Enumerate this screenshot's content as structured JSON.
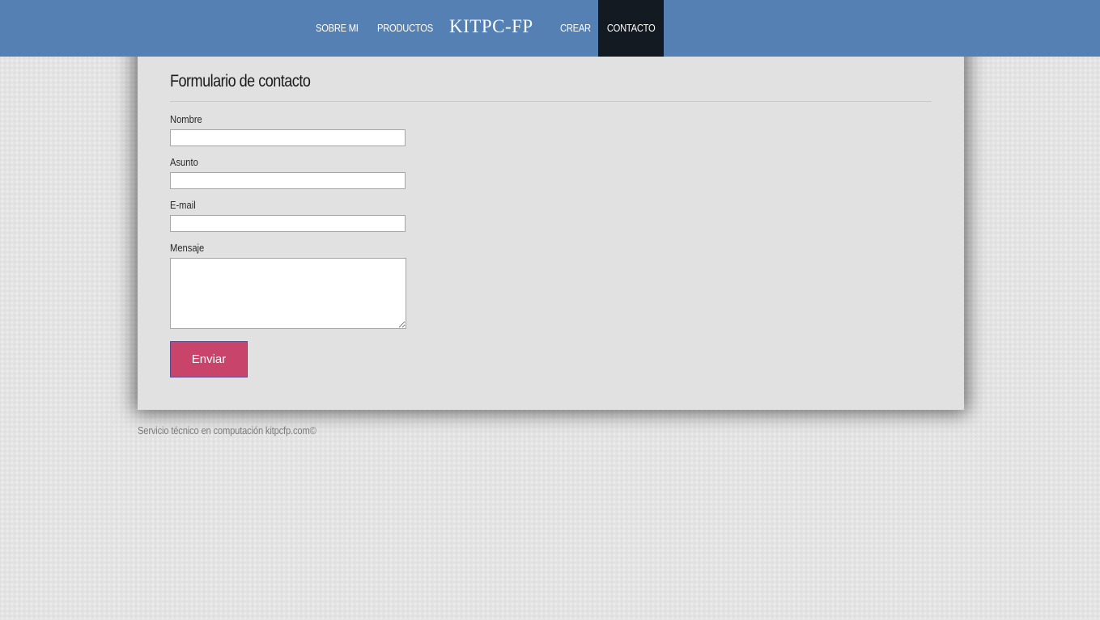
{
  "nav": {
    "logo": "KITPC-FP",
    "items": [
      {
        "label": "SOBRE MI"
      },
      {
        "label": "PRODUCTOS"
      },
      {
        "label": "CREAR"
      },
      {
        "label": "CONTACTO",
        "active": true
      }
    ]
  },
  "form": {
    "title": "Formulario de contacto",
    "fields": {
      "nombre": {
        "label": "Nombre",
        "value": ""
      },
      "asunto": {
        "label": "Asunto",
        "value": ""
      },
      "email": {
        "label": "E-mail",
        "value": ""
      },
      "mensaje": {
        "label": "Mensaje",
        "value": ""
      }
    },
    "submit_label": "Enviar"
  },
  "footer": {
    "text": "Servicio técnico en computación kitpcfp.com©"
  },
  "colors": {
    "nav_bg": "#5480b3",
    "active_nav_bg": "#131a22",
    "card_bg": "#e1e1e1",
    "button_bg": "#c8446b"
  }
}
